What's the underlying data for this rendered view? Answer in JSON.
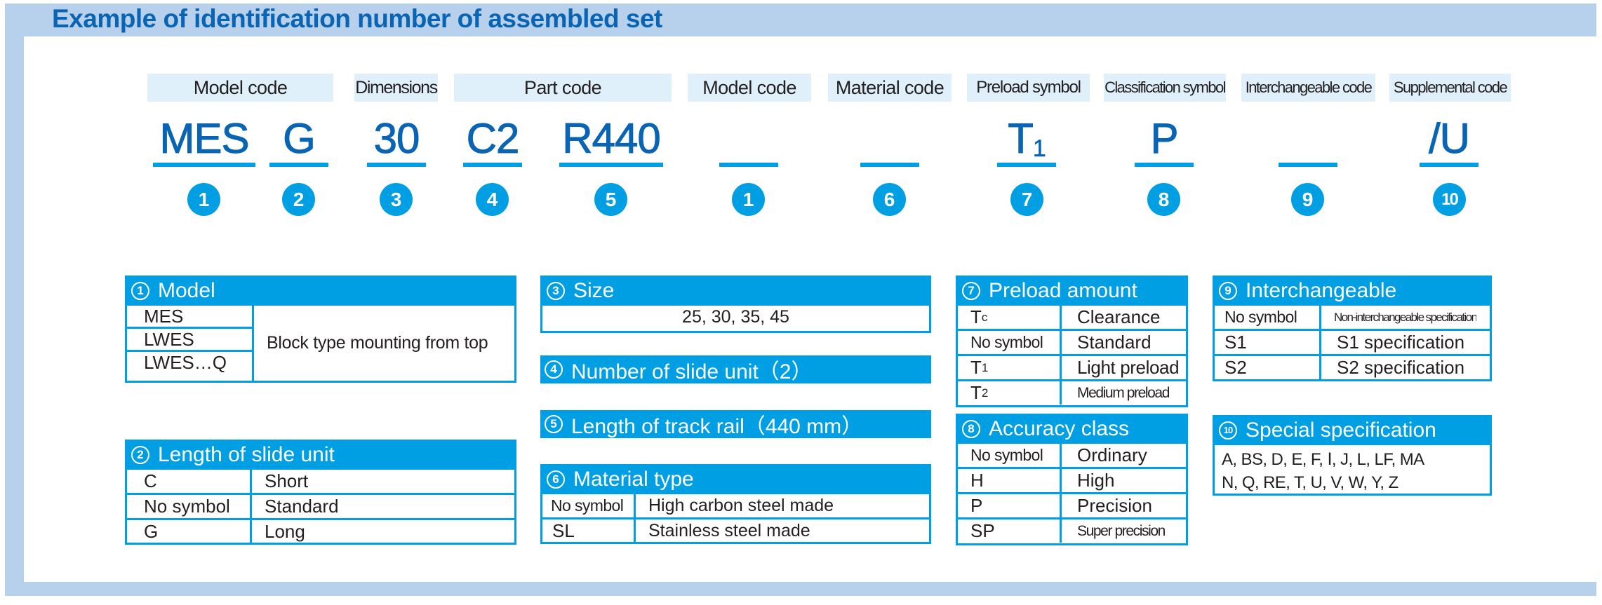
{
  "title": "Example of identification number of assembled set",
  "colors": {
    "frame": "#b7d0ec",
    "title": "#0a64b4",
    "accent": "#009fe3",
    "label_bg": "#dff0fa",
    "code": "#0a64b4"
  },
  "labels": [
    "Model code",
    "Dimensions",
    "Part code",
    "Model code",
    "Material code",
    "Preload symbol",
    "Classification symbol",
    "Interchangeable code",
    "Supplemental code"
  ],
  "codes": [
    {
      "text": "MES",
      "sub": "",
      "num": "1"
    },
    {
      "text": "G",
      "sub": "",
      "num": "2"
    },
    {
      "text": "30",
      "sub": "",
      "num": "3"
    },
    {
      "text": "C2",
      "sub": "",
      "num": "4"
    },
    {
      "text": "R440",
      "sub": "",
      "num": "5"
    },
    {
      "text": "",
      "sub": "",
      "num": "1"
    },
    {
      "text": "",
      "sub": "",
      "num": "6"
    },
    {
      "text": "T",
      "sub": "1",
      "num": "7"
    },
    {
      "text": "P",
      "sub": "",
      "num": "8"
    },
    {
      "text": "",
      "sub": "",
      "num": "9"
    },
    {
      "text": "/U",
      "sub": "",
      "num": "10"
    }
  ],
  "tables": {
    "model": {
      "num": "1",
      "title": "Model",
      "keys": [
        "MES",
        "LWES",
        "LWES…Q"
      ],
      "value": "Block type mounting from top"
    },
    "length_slide": {
      "num": "2",
      "title": "Length of slide unit",
      "rows": [
        [
          "C",
          "Short"
        ],
        [
          "No symbol",
          "Standard"
        ],
        [
          "G",
          "Long"
        ]
      ]
    },
    "size": {
      "num": "3",
      "title": "Size",
      "value": "25, 30, 35, 45"
    },
    "number_slide": {
      "num": "4",
      "title": "Number of slide unit（2）"
    },
    "length_rail": {
      "num": "5",
      "title": "Length of track rail（440 mm）"
    },
    "material": {
      "num": "6",
      "title": "Material type",
      "rows": [
        [
          "No symbol",
          "High carbon steel made"
        ],
        [
          "SL",
          "Stainless steel made"
        ]
      ]
    },
    "preload": {
      "num": "7",
      "title": "Preload amount",
      "rows": [
        {
          "k": "T",
          "ksub": "c",
          "v": "Clearance"
        },
        {
          "k": "No symbol",
          "ksub": "",
          "v": "Standard"
        },
        {
          "k": "T",
          "ksub": "1",
          "v": "Light preload"
        },
        {
          "k": "T",
          "ksub": "2",
          "v": "Medium preload"
        }
      ]
    },
    "accuracy": {
      "num": "8",
      "title": "Accuracy class",
      "rows": [
        [
          "No symbol",
          "Ordinary"
        ],
        [
          "H",
          "High"
        ],
        [
          "P",
          "Precision"
        ],
        [
          "SP",
          "Super precision"
        ]
      ]
    },
    "interchangeable": {
      "num": "9",
      "title": "Interchangeable",
      "rows": [
        [
          "No symbol",
          "Non-interchangeable specification"
        ],
        [
          "S1",
          "S1 specification"
        ],
        [
          "S2",
          "S2 specification"
        ]
      ]
    },
    "special": {
      "num": "10",
      "title": "Special specification",
      "lines": [
        "A, BS, D, E, F, Ⅰ, J, L, LF, MA",
        "N, Q, RE, T, U, V, W, Y, Z"
      ]
    }
  }
}
